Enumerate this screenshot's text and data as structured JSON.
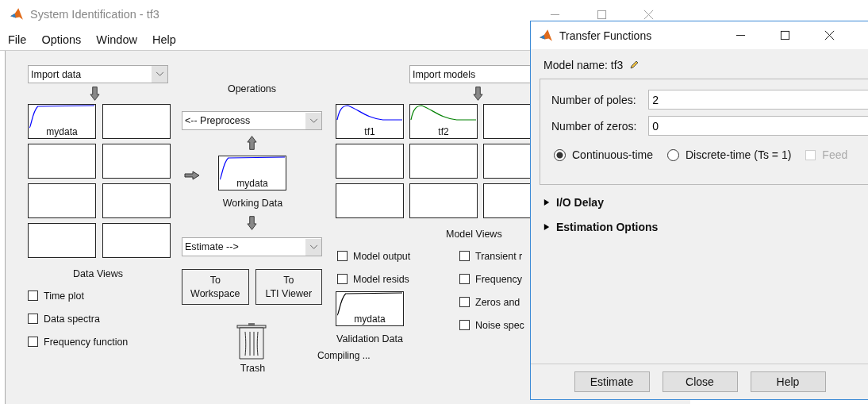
{
  "main_window": {
    "title": "System Identification - tf3",
    "menu": [
      "File",
      "Options",
      "Window",
      "Help"
    ],
    "data_panel": {
      "import": "Import data",
      "tiles": [
        {
          "kind": "step",
          "label": "mydata",
          "color": "#0000ff"
        },
        {
          "kind": "empty"
        },
        {
          "kind": "empty"
        },
        {
          "kind": "empty"
        },
        {
          "kind": "empty"
        },
        {
          "kind": "empty"
        },
        {
          "kind": "empty"
        },
        {
          "kind": "empty"
        }
      ],
      "title": "Data Views",
      "views": [
        {
          "label": "Time plot",
          "checked": false
        },
        {
          "label": "Data spectra",
          "checked": false
        },
        {
          "label": "Frequency function",
          "checked": false
        }
      ]
    },
    "operations": {
      "title": "Operations",
      "preprocess": "<-- Preprocess",
      "working_data": {
        "kind": "step",
        "label": "mydata",
        "color": "#0000ff"
      },
      "working_caption": "Working Data",
      "estimate": "Estimate -->",
      "buttons": [
        {
          "lines": [
            "To",
            "Workspace"
          ]
        },
        {
          "lines": [
            "To",
            "LTI Viewer"
          ]
        }
      ],
      "trash": "Trash"
    },
    "model_panel": {
      "import": "Import models",
      "tiles": [
        {
          "kind": "peak",
          "label": "tf1",
          "color": "#0000ff"
        },
        {
          "kind": "peak",
          "label": "tf2",
          "color": "#008000"
        },
        {
          "kind": "empty"
        },
        {
          "kind": "empty"
        },
        {
          "kind": "empty"
        },
        {
          "kind": "empty"
        },
        {
          "kind": "empty"
        },
        {
          "kind": "empty"
        },
        {
          "kind": "empty"
        }
      ],
      "title": "Model Views",
      "views_left": [
        {
          "label": "Model output",
          "checked": false
        },
        {
          "label": "Model resids",
          "checked": false
        }
      ],
      "views_right": [
        {
          "label": "Transient r",
          "checked": false
        },
        {
          "label": "Frequency",
          "checked": false
        },
        {
          "label": "Zeros and",
          "checked": false
        },
        {
          "label": "Noise spec",
          "checked": false
        }
      ],
      "validation_data": {
        "kind": "step",
        "label": "mydata",
        "color": "#000000"
      },
      "validation_caption": "Validation Data"
    },
    "status": "Compiling ..."
  },
  "dialog": {
    "title": "Transfer Functions",
    "model_name": "Model name: tf3",
    "fields": [
      {
        "label": "Number of poles:",
        "value": "2"
      },
      {
        "label": "Number of zeros:",
        "value": "0"
      }
    ],
    "time_domain": [
      {
        "label": "Continuous-time",
        "selected": true
      },
      {
        "label": "Discrete-time (Ts = 1)",
        "selected": false
      }
    ],
    "feedthrough": {
      "label": "Feed",
      "checked": false,
      "disabled": true
    },
    "sections": [
      {
        "label": "I/O Delay",
        "expanded": false
      },
      {
        "label": "Estimation Options",
        "expanded": false
      }
    ],
    "buttons": [
      "Estimate",
      "Close",
      "Help"
    ]
  }
}
